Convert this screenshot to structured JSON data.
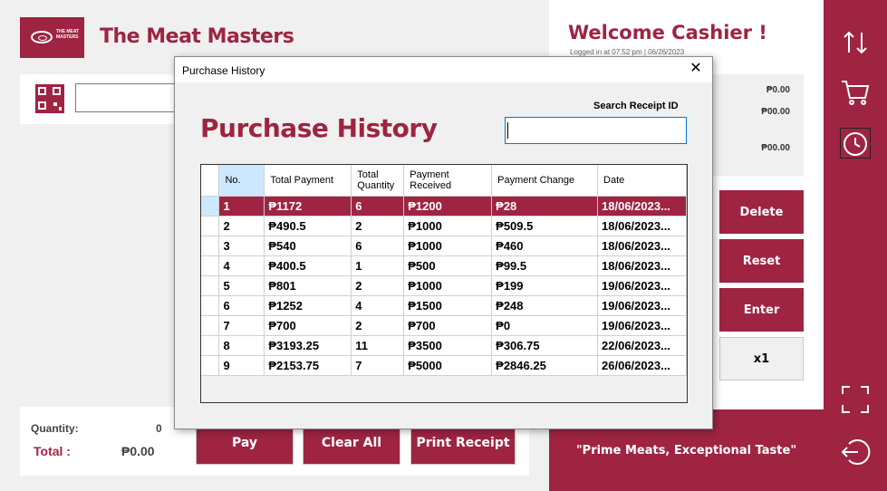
{
  "app": {
    "logo_text": "THE MEAT MASTERS",
    "title": "The Meat Masters",
    "welcome": "Welcome Cashier !",
    "login_info": "Logged in at 07:52 pm | 06/26/2023",
    "tagline": "\"Prime Meats, Exceptional Taste\"",
    "accent_color": "#9e2442"
  },
  "summary": {
    "line1": "₱0.00",
    "line2": "₱00.00",
    "line3": "₱00.00"
  },
  "totals": {
    "quantity_label": "Quantity:",
    "quantity_value": "0",
    "total_label": "Total :",
    "total_value": "₱0.00"
  },
  "buttons": {
    "pay": "Pay",
    "clear_all": "Clear All",
    "print_receipt": "Print Receipt",
    "delete": "Delete",
    "reset": "Reset",
    "enter": "Enter",
    "multiplier": "x1"
  },
  "sidebar": {
    "icons": [
      "swap-arrows-icon",
      "cart-icon",
      "history-clock-icon",
      "fullscreen-icon",
      "logout-icon"
    ]
  },
  "dialog": {
    "window_title": "Purchase History",
    "heading": "Purchase History",
    "search_label": "Search Receipt ID",
    "search_value": "",
    "columns": [
      "No.",
      "Total Payment",
      "Total Quantity",
      "Payment Received",
      "Payment Change",
      "Date"
    ],
    "rows": [
      [
        "1",
        "₱1172",
        "6",
        "₱1200",
        "₱28",
        "18/06/2023..."
      ],
      [
        "2",
        "₱490.5",
        "2",
        "₱1000",
        "₱509.5",
        "18/06/2023..."
      ],
      [
        "3",
        "₱540",
        "6",
        "₱1000",
        "₱460",
        "18/06/2023..."
      ],
      [
        "4",
        "₱400.5",
        "1",
        "₱500",
        "₱99.5",
        "18/06/2023..."
      ],
      [
        "5",
        "₱801",
        "2",
        "₱1000",
        "₱199",
        "19/06/2023..."
      ],
      [
        "6",
        "₱1252",
        "4",
        "₱1500",
        "₱248",
        "19/06/2023..."
      ],
      [
        "7",
        "₱700",
        "2",
        "₱700",
        "₱0",
        "19/06/2023..."
      ],
      [
        "8",
        "₱3193.25",
        "11",
        "₱3500",
        "₱306.75",
        "22/06/2023..."
      ],
      [
        "9",
        "₱2153.75",
        "7",
        "₱5000",
        "₱2846.25",
        "26/06/2023..."
      ]
    ],
    "selected_row": 0
  }
}
